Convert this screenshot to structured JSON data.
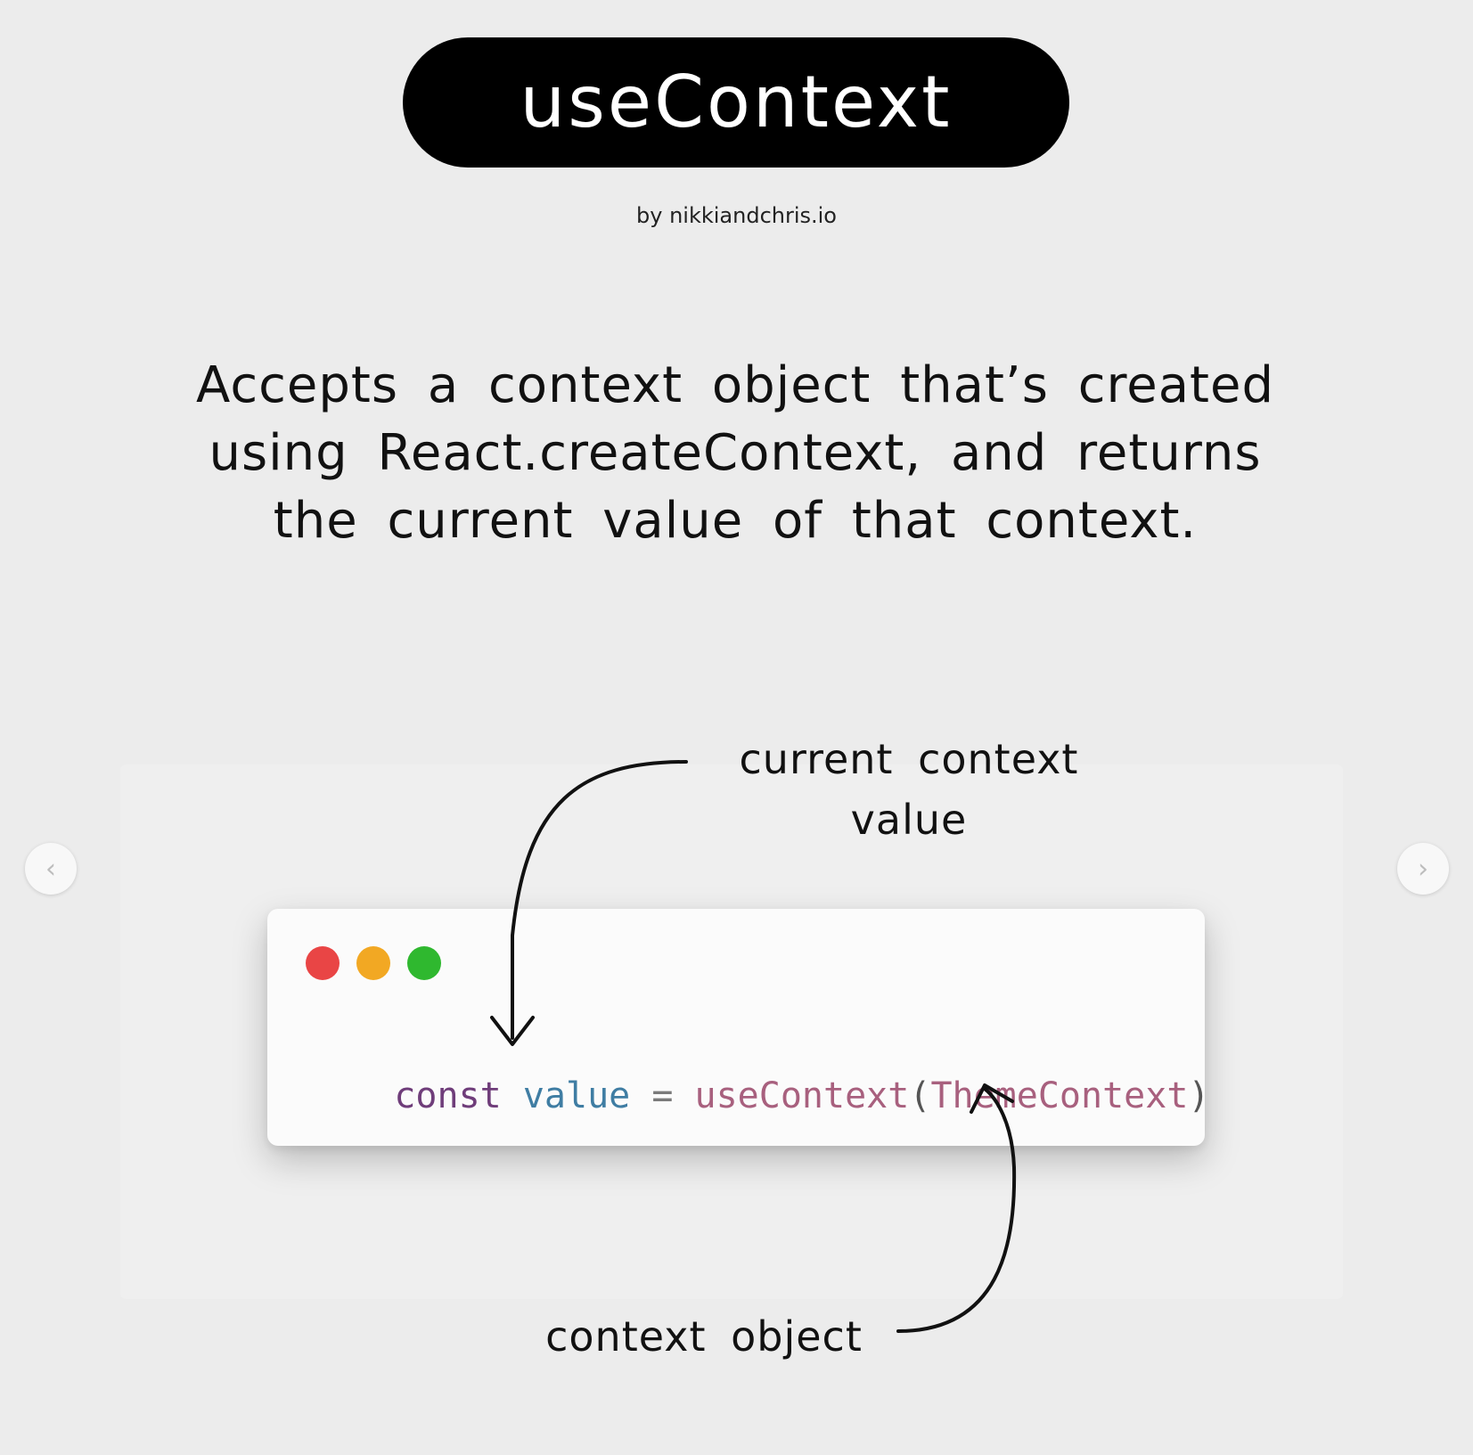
{
  "title": "useContext",
  "byline": "by nikkiandchris.io",
  "description": "Accepts a context object that’s created using React.createContext, and returns the current value of that context.",
  "code": {
    "tokens": [
      {
        "text": "const",
        "color": "#6f3d7a"
      },
      {
        "text": " ",
        "color": "#333333"
      },
      {
        "text": "value",
        "color": "#3f7da3"
      },
      {
        "text": " = ",
        "color": "#7a7a7a"
      },
      {
        "text": "useContext",
        "color": "#a8607e"
      },
      {
        "text": "(",
        "color": "#555555"
      },
      {
        "text": "ThemeContext",
        "color": "#a8607e"
      },
      {
        "text": ")",
        "color": "#555555"
      }
    ]
  },
  "window_dots": {
    "red": "#e94545",
    "yellow": "#f2a823",
    "green": "#2fb82f"
  },
  "annotations": {
    "value_label": "current context value",
    "object_label": "context object"
  },
  "navigation": {
    "prev_icon": "chevron-left-icon",
    "next_icon": "chevron-right-icon"
  }
}
